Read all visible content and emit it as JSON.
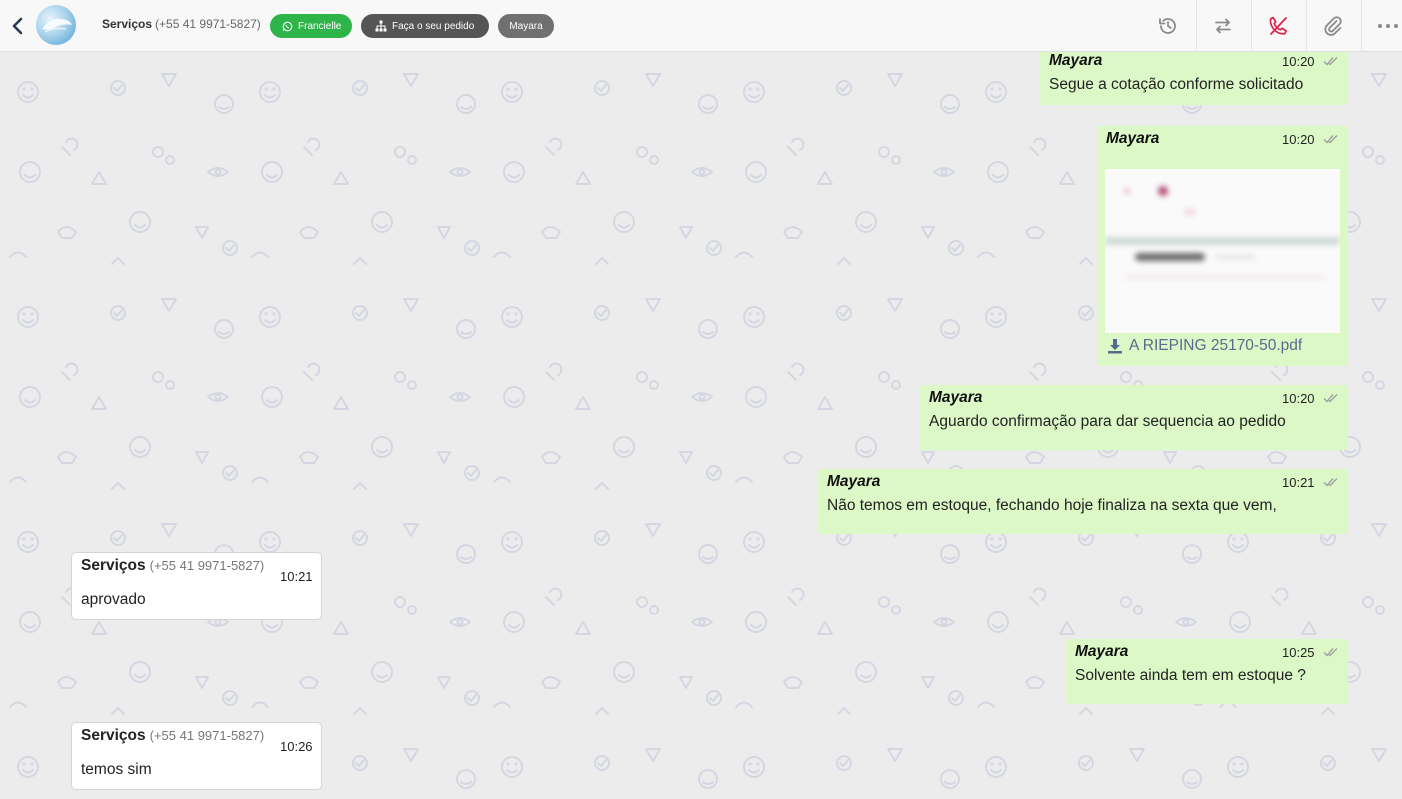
{
  "header": {
    "contact_name": "Serviços",
    "contact_phone": "(+55 41 9971-5827)",
    "chips": {
      "whatsapp": "Francielle",
      "flow": "Faça o seu pedido",
      "agent": "Mayara"
    },
    "icons": [
      "back-icon",
      "history-icon",
      "transfer-icon",
      "end-call-icon",
      "attach-icon",
      "more-icon"
    ]
  },
  "colors": {
    "chat_background": "#ececec",
    "outgoing_bubble": "#dcf8c6",
    "incoming_bubble": "#ffffff",
    "whatsapp_chip": "#2fb44a",
    "end_call_icon": "#e0224a"
  },
  "messages": [
    {
      "direction": "out",
      "sender": "Mayara",
      "time": "10:20",
      "text": "Segue a cotação conforme solicitado"
    },
    {
      "direction": "out",
      "sender": "Mayara",
      "time": "10:20",
      "attachment": {
        "filename": "A RIEPING 25170-50.pdf"
      }
    },
    {
      "direction": "out",
      "sender": "Mayara",
      "time": "10:20",
      "text": "Aguardo confirmação para dar sequencia ao pedido"
    },
    {
      "direction": "out",
      "sender": "Mayara",
      "time": "10:21",
      "text": "Não temos em estoque, fechando hoje finaliza na sexta que vem,"
    },
    {
      "direction": "in",
      "sender": "Serviços",
      "phone": "(+55 41 9971-5827)",
      "time": "10:21",
      "text": "aprovado"
    },
    {
      "direction": "out",
      "sender": "Mayara",
      "time": "10:25",
      "text": "Solvente ainda tem em estoque ?"
    },
    {
      "direction": "in",
      "sender": "Serviços",
      "phone": "(+55 41 9971-5827)",
      "time": "10:26",
      "text": "temos sim"
    }
  ]
}
